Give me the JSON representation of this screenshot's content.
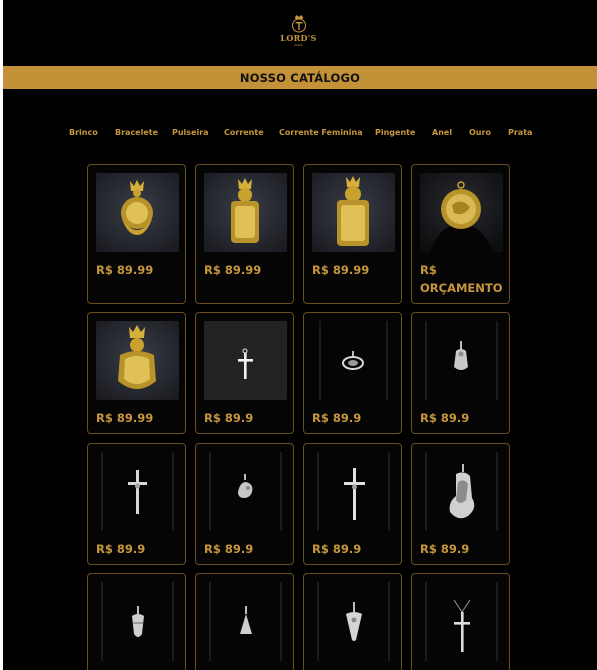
{
  "brand": {
    "logo_text": "LORD'S",
    "logo_subtext": "JOIAS",
    "accent_color": "#c6973c",
    "banner_color": "#c39138"
  },
  "banner": {
    "title": "NOSSO CATÁLOGO"
  },
  "categories": [
    "Brinco",
    "Bracelete",
    "Pulseira",
    "Corrente",
    "Corrente Feminina",
    "Pingente",
    "Anel",
    "Ouro",
    "Prata"
  ],
  "products": [
    {
      "price_line1": "R$ 89.99",
      "price_line2": "",
      "image": "gold-crown-medallion-pendant-icon"
    },
    {
      "price_line1": "R$ 89.99",
      "price_line2": "",
      "image": "gold-crown-plaque-pendant-icon"
    },
    {
      "price_line1": "R$ 89.99",
      "price_line2": "",
      "image": "gold-crown-plaque-pendant-icon"
    },
    {
      "price_line1": "R$",
      "price_line2": "ORÇAMENTO",
      "image": "gold-round-medallion-pendant-icon"
    },
    {
      "price_line1": "R$ 89.99",
      "price_line2": "",
      "image": "gold-crown-medallion-pendant-icon"
    },
    {
      "price_line1": "R$ 89.9",
      "price_line2": "",
      "image": "silver-cross-pendant-icon"
    },
    {
      "price_line1": "R$ 89.9",
      "price_line2": "",
      "image": "silver-oval-pendant-icon"
    },
    {
      "price_line1": "R$ 89.9",
      "price_line2": "",
      "image": "silver-figure-pendant-icon"
    },
    {
      "price_line1": "R$ 89.9",
      "price_line2": "",
      "image": "silver-crucifix-pendant-icon"
    },
    {
      "price_line1": "R$ 89.9",
      "price_line2": "",
      "image": "silver-hand-pendant-icon"
    },
    {
      "price_line1": "R$ 89.9",
      "price_line2": "",
      "image": "silver-crucifix-pendant-icon"
    },
    {
      "price_line1": "R$ 89.9",
      "price_line2": "",
      "image": "silver-saint-pendant-icon"
    },
    {
      "price_line1": "",
      "price_line2": "",
      "image": "silver-figure-pendant-icon"
    },
    {
      "price_line1": "",
      "price_line2": "",
      "image": "silver-figure-pendant-icon"
    },
    {
      "price_line1": "",
      "price_line2": "",
      "image": "silver-figure-pendant-icon"
    },
    {
      "price_line1": "",
      "price_line2": "",
      "image": "silver-crucifix-pendant-icon"
    }
  ]
}
